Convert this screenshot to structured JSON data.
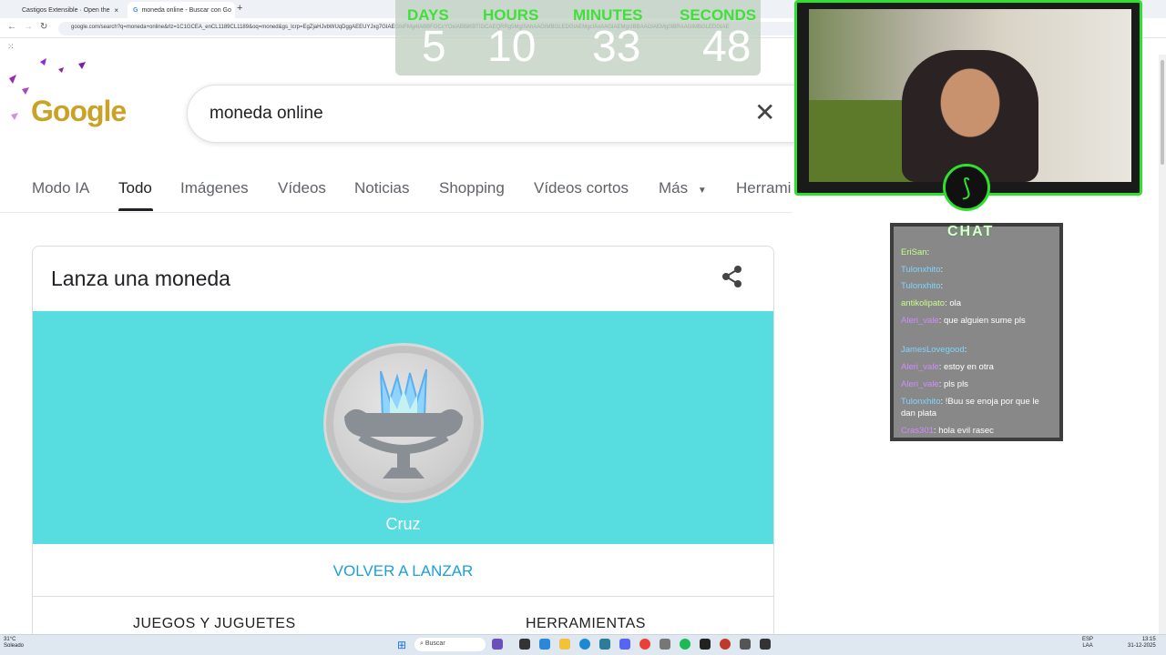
{
  "browser": {
    "tabs": [
      {
        "title": "Castigos Extensible · Open the",
        "active": false
      },
      {
        "title": "moneda online - Buscar con Go",
        "active": true
      }
    ],
    "new_tab": "+",
    "url": "google.com/search?q=moneda+online&rlz=1C1GCEA_enCL1189CL1189&oq=moned&gs_lcrp=EgZjaHJvbWUqDggAEEUYJxg7GIAEGIoFMg4IABBFGCcYOxiABBiKBTIGCAEQRRg5Mg0IAhAAGIMBGLEDGIAEMgcIAxAAGIAEMgcIBBAAGIAEMg0IBRAAGIMBGLEDGIAE",
    "back": "←",
    "forward": "→",
    "reload": "↻"
  },
  "google": {
    "logo": "Google",
    "query": "moneda online",
    "clear": "✕",
    "tabs": [
      "Modo IA",
      "Todo",
      "Imágenes",
      "Vídeos",
      "Noticias",
      "Shopping",
      "Vídeos cortos",
      "Más",
      "Herrami"
    ],
    "active_tab": "Todo"
  },
  "coin_card": {
    "title": "Lanza una moneda",
    "result": "Cruz",
    "relaunch": "VOLVER A LANZAR",
    "footer_left": "JUEGOS Y JUGUETES",
    "footer_right": "HERRAMIENTAS",
    "area_color": "#57dcdf"
  },
  "countdown": {
    "labels": [
      "DAYS",
      "HOURS",
      "MINUTES",
      "SECONDS"
    ],
    "values": [
      "5",
      "10",
      "33",
      "48"
    ]
  },
  "chat": {
    "title": "CHAT",
    "messages": [
      {
        "user": "EriSan",
        "text": ""
      },
      {
        "user": "Tulonxhito",
        "text": ""
      },
      {
        "user": "Tulonxhito",
        "text": ""
      },
      {
        "user": "antikolipato",
        "text": "ola"
      },
      {
        "user": "Aleri_vale",
        "text": "que alguien sume pls"
      },
      {
        "user": "JamesLovegood",
        "text": ""
      },
      {
        "user": "Aleri_vale",
        "text": "estoy en otra"
      },
      {
        "user": "Aleri_vale",
        "text": "pls pls"
      },
      {
        "user": "Tulonxhito",
        "text": "!Buu se enoja por que le dan plata"
      },
      {
        "user": "Cras301",
        "text": "hola evil rasec"
      }
    ]
  },
  "taskbar": {
    "weather_temp": "31°C",
    "weather_desc": "Soleado",
    "search": "Buscar",
    "lang": "ESP",
    "lang2": "LAA",
    "time": "13:15",
    "date": "31-12-2025"
  }
}
